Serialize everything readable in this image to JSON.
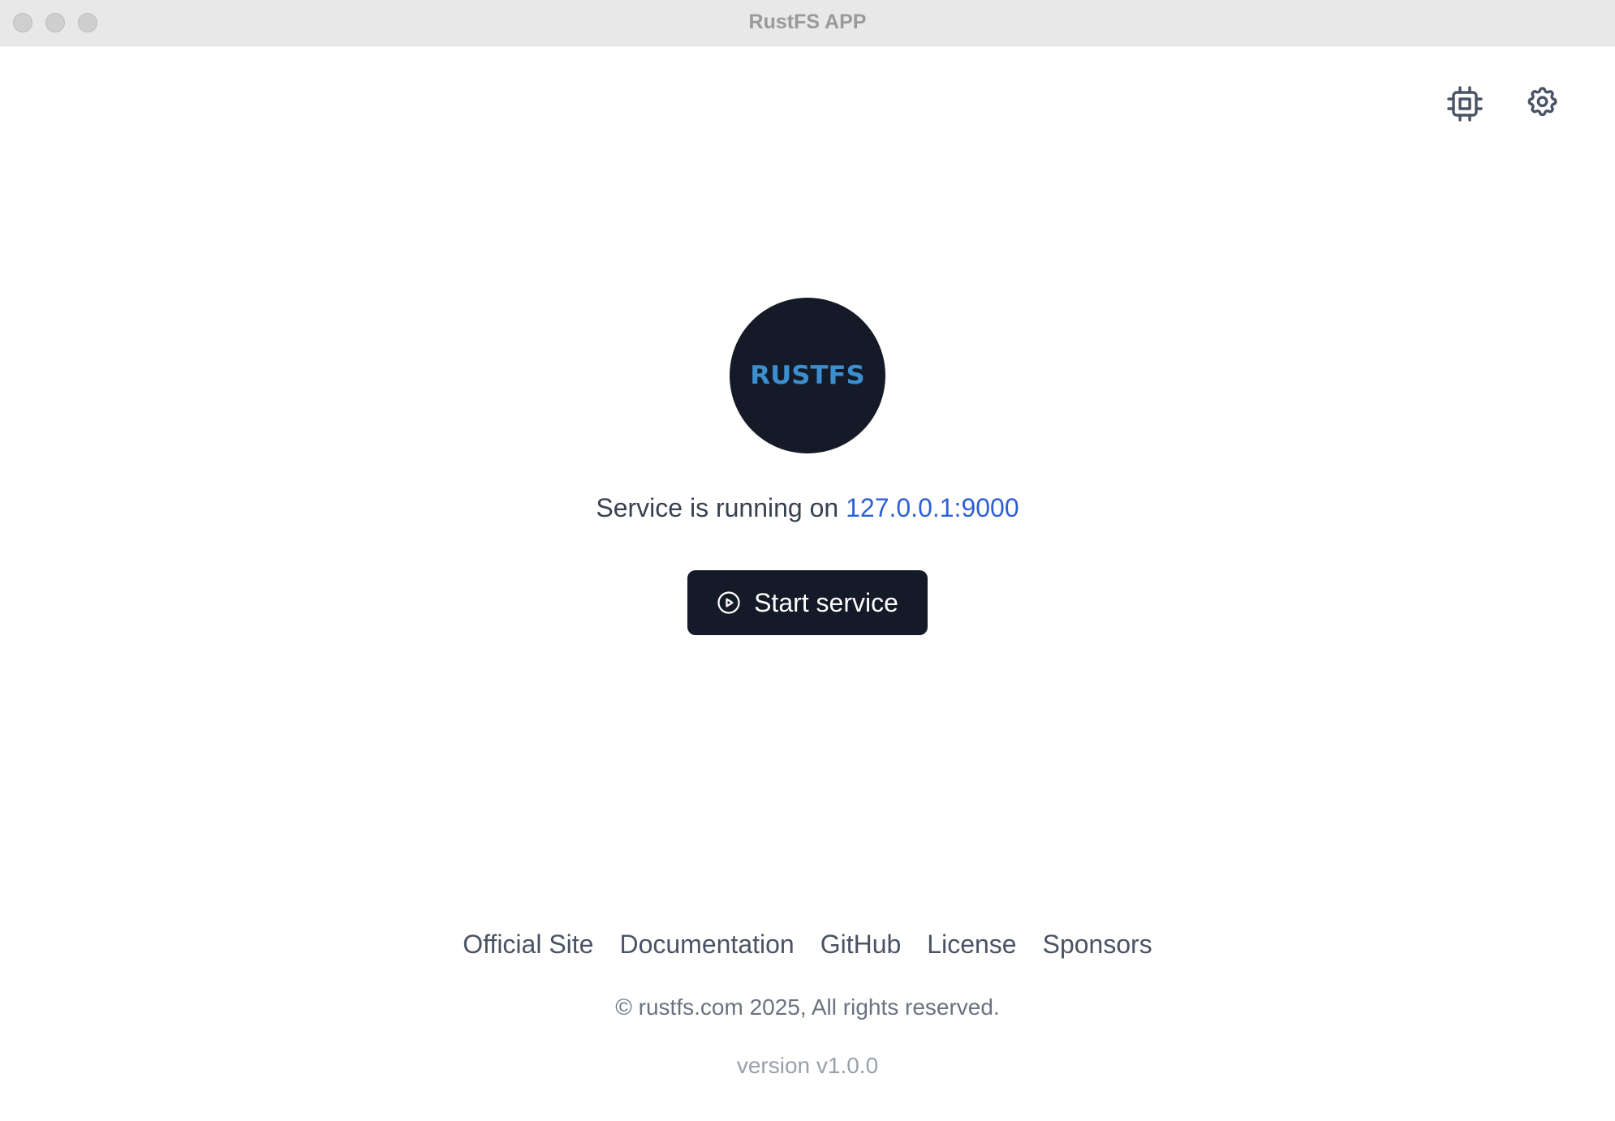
{
  "window": {
    "title": "RustFS APP"
  },
  "toolbar": {
    "cpu_icon": "cpu-chip-icon",
    "settings_icon": "gear-icon"
  },
  "logo": {
    "text": "RUSTFS",
    "background": "#151a28",
    "text_color": "#3b8fd0"
  },
  "status": {
    "prefix": "Service is running on",
    "address": "127.0.0.1:9000",
    "address_color": "#2f5fd6"
  },
  "start_button": {
    "label": "Start service",
    "icon": "play-circle-icon",
    "background": "#151a28"
  },
  "footer": {
    "links": [
      "Official Site",
      "Documentation",
      "GitHub",
      "License",
      "Sponsors"
    ],
    "copyright": "© rustfs.com 2025, All rights reserved.",
    "version": "version v1.0.0"
  }
}
